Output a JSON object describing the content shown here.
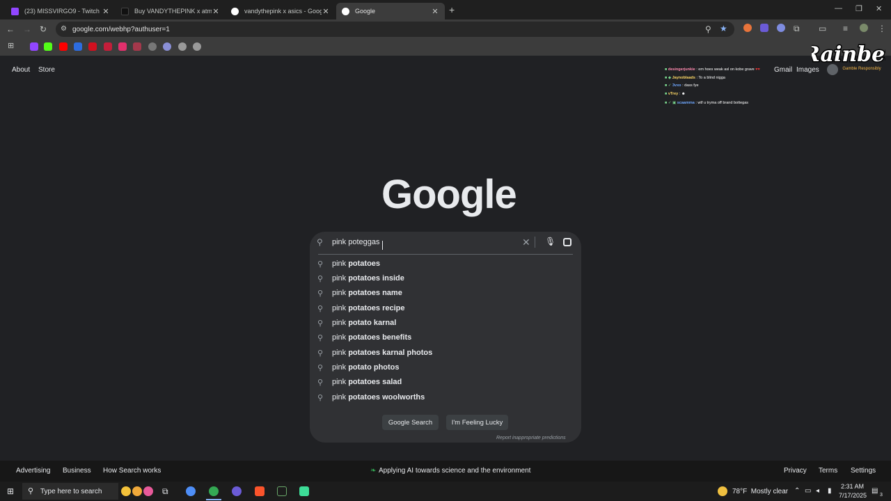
{
  "tabs": [
    {
      "title": "(23) MISSVIRGO9 - Twitch",
      "favicon": "twitch-icon",
      "color": "#9146ff",
      "active": false
    },
    {
      "title": "Buy VANDYTHEPINK x atmos x",
      "favicon": "shop-icon",
      "color": "#111111",
      "active": false
    },
    {
      "title": "vandythepink x asics - Google S",
      "favicon": "google-icon",
      "color": "#ffffff",
      "active": false
    },
    {
      "title": "Google",
      "favicon": "google-icon",
      "color": "#ffffff",
      "active": true
    }
  ],
  "address_bar": {
    "url": "google.com/webhp?authuser=1"
  },
  "page": {
    "top_left_links": [
      "About",
      "Store"
    ],
    "top_right_links": [
      "Gmail",
      "Images"
    ],
    "logo_text": "Google",
    "search": {
      "query": "pink poteggas",
      "suggestions": [
        {
          "plain": "pink",
          "bold": "potatoes"
        },
        {
          "plain": "pink",
          "bold": "potatoes inside"
        },
        {
          "plain": "pink",
          "bold": "potatoes name"
        },
        {
          "plain": "pink",
          "bold": "potatoes recipe"
        },
        {
          "plain": "pink",
          "bold": "potato karnal"
        },
        {
          "plain": "pink",
          "bold": "potatoes benefits"
        },
        {
          "plain": "pink",
          "bold": "potatoes karnal photos"
        },
        {
          "plain": "pink",
          "bold": "potato photos"
        },
        {
          "plain": "pink",
          "bold": "potatoes salad"
        },
        {
          "plain": "pink",
          "bold": "potatoes woolworths"
        }
      ],
      "google_search_label": "Google Search",
      "feeling_lucky_label": "I'm Feeling Lucky",
      "report_label": "Report inappropriate predictions"
    },
    "footer": {
      "left": [
        "Advertising",
        "Business",
        "How Search works"
      ],
      "center": "Applying AI towards science and the environment",
      "right": [
        "Privacy",
        "Terms",
        "Settings"
      ]
    }
  },
  "overlay": {
    "chat": [
      {
        "user": "desingerjunkie",
        "message": ": em hoes weak asl on kobe grave",
        "color": "#ff8ab0"
      },
      {
        "user": "Jaynoblaads",
        "message": ": To a blind nigga",
        "color": "#ffd966"
      },
      {
        "user": "3vxo",
        "message": ": dass fye",
        "color": "#6fa8ff"
      },
      {
        "user": "vTrey",
        "message": ":",
        "color": "#ffd966"
      },
      {
        "user": "scaamma",
        "message": ": wtf u tryma off brand bottegas",
        "color": "#6fa8ff"
      }
    ],
    "brand": "Rainbet",
    "brand_tagline": "Gamble Responsibly"
  },
  "taskbar": {
    "search_placeholder": "Type here to search",
    "weather": "78°F  Mostly clear",
    "time": "2:31 AM",
    "date": "7/17/2025",
    "notification_count": "3"
  }
}
